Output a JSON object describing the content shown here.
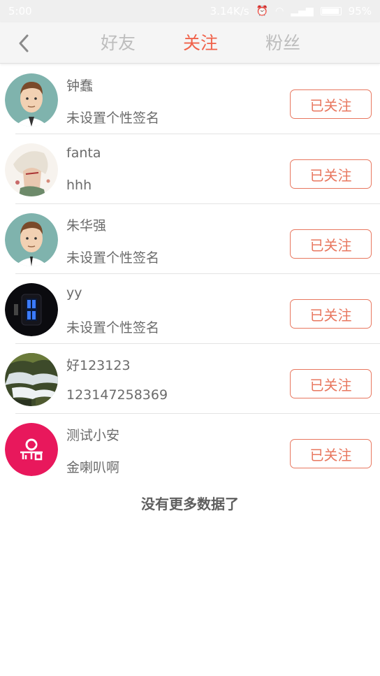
{
  "status_bar": {
    "time": "5:00",
    "network_speed": "3.14K/s",
    "battery": "95%"
  },
  "nav": {
    "back_icon": "chevron-left-icon",
    "tabs": [
      {
        "label": "好友",
        "active": false
      },
      {
        "label": "关注",
        "active": true
      },
      {
        "label": "粉丝",
        "active": false
      }
    ]
  },
  "colors": {
    "accent": "#f0624a",
    "button_border": "#e8775f",
    "text_gray": "#6b6b6b"
  },
  "list": {
    "items": [
      {
        "name": "钟蠢",
        "signature": "未设置个性签名",
        "button": "已关注",
        "avatar": "cartoon-man-avatar"
      },
      {
        "name": "fanta",
        "signature": "hhh",
        "button": "已关注",
        "avatar": "anime-character-avatar"
      },
      {
        "name": "朱华强",
        "signature": "未设置个性签名",
        "button": "已关注",
        "avatar": "cartoon-man-avatar"
      },
      {
        "name": "yy",
        "signature": "未设置个性签名",
        "button": "已关注",
        "avatar": "digital-watch-avatar"
      },
      {
        "name": "好123123",
        "signature": "123147258369",
        "button": "已关注",
        "avatar": "waterfall-photo-avatar"
      },
      {
        "name": "测试小安",
        "signature": "金喇叭啊",
        "button": "已关注",
        "avatar": "brand-logo-avatar"
      }
    ]
  },
  "footer_note": "没有更多数据了"
}
